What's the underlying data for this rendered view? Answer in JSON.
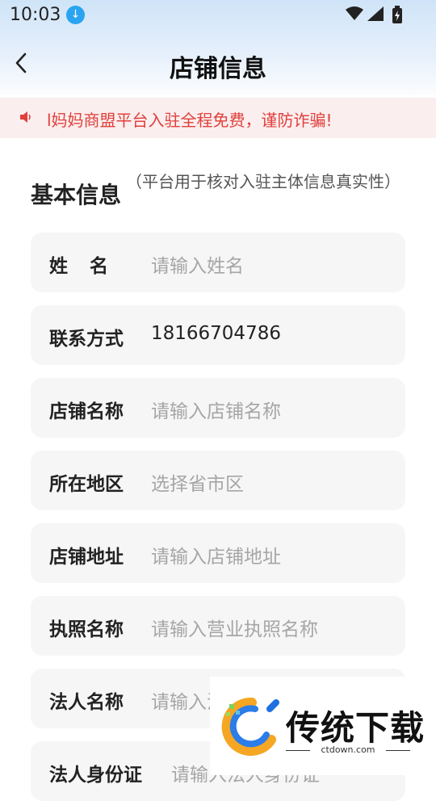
{
  "status_bar": {
    "time": "10:03",
    "icons": [
      "download-icon",
      "wifi-icon",
      "signal-icon",
      "battery-icon"
    ]
  },
  "header": {
    "title": "店铺信息",
    "back_icon": "chevron-left-icon"
  },
  "notice": {
    "icon": "speaker-icon",
    "text": "l妈妈商盟平台入驻全程免费，谨防诈骗!"
  },
  "section": {
    "title": "基本信息",
    "subtitle": "（平台用于核对入驻主体信息真实性）"
  },
  "fields": [
    {
      "label": "姓名",
      "placeholder": "请输入姓名"
    },
    {
      "label": "联系方式",
      "value": "18166704786"
    },
    {
      "label": "店铺名称",
      "placeholder": "请输入店铺名称"
    },
    {
      "label": "所在地区",
      "placeholder": "选择省市区"
    },
    {
      "label": "店铺地址",
      "placeholder": "请输入店铺地址"
    },
    {
      "label": "执照名称",
      "placeholder": "请输入营业执照名称"
    },
    {
      "label": "法人名称",
      "placeholder": "请输入法人名称"
    },
    {
      "label": "法人身份证",
      "placeholder": "请输入法人身份证"
    }
  ],
  "watermark": {
    "text": "传统下载",
    "domain": "ctdown.com"
  },
  "colors": {
    "accent_red": "#e0403c",
    "notice_bg": "#fbeeee",
    "field_bg": "#f6f6f7",
    "placeholder": "#a6a6a6"
  }
}
